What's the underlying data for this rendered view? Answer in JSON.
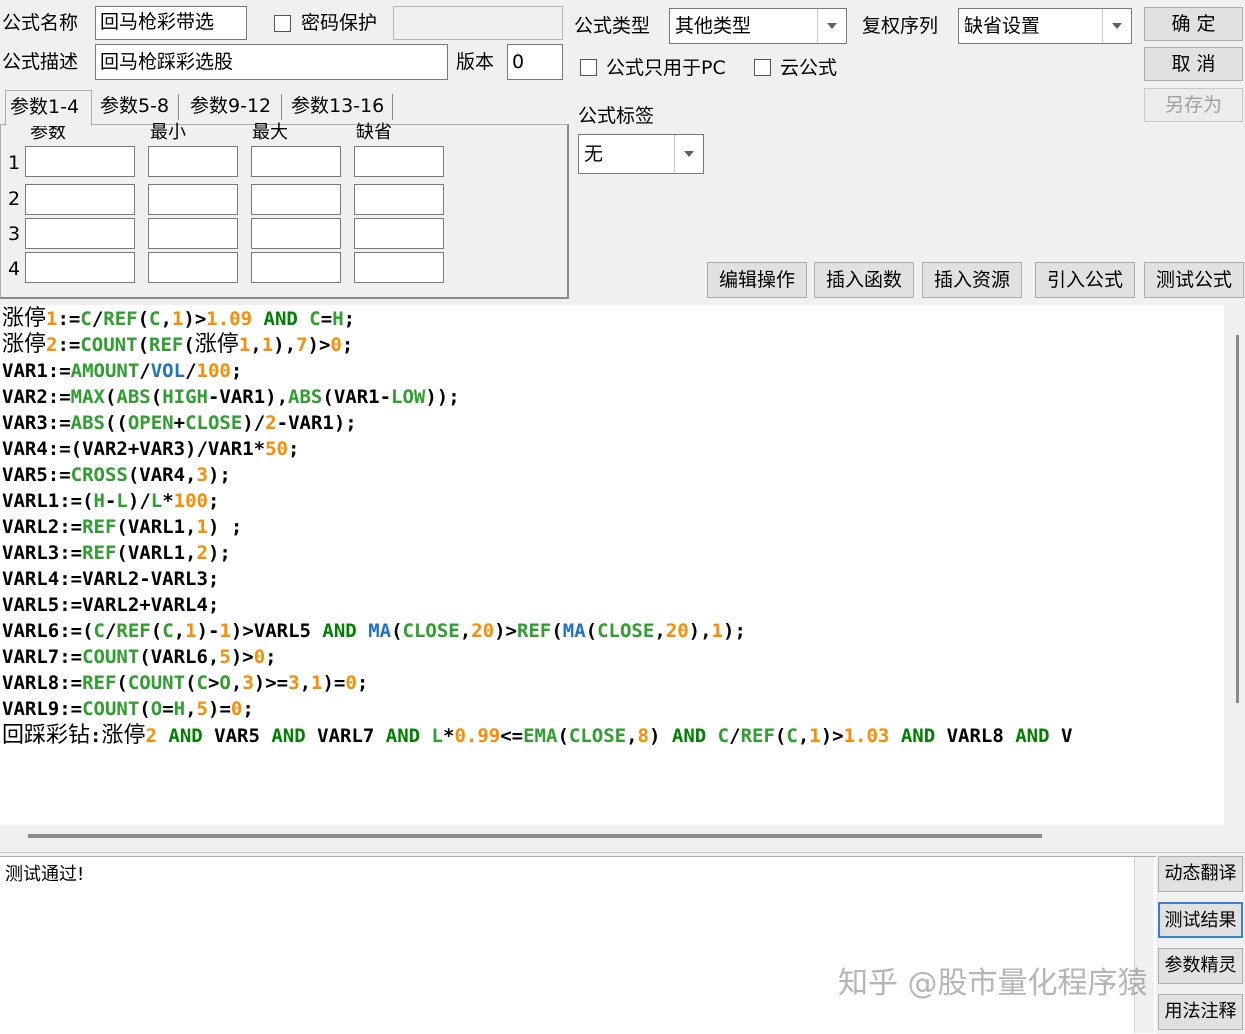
{
  "form": {
    "name_label": "公式名称",
    "name_value": "回马枪彩带选",
    "password_label": "密码保护",
    "password_value": "",
    "desc_label": "公式描述",
    "desc_value": "回马枪踩彩选股",
    "version_label": "版本",
    "version_value": "0",
    "type_label": "公式类型",
    "type_value": "其他类型",
    "rights_label": "复权序列",
    "rights_value": "缺省设置",
    "pc_only_label": "公式只用于PC",
    "cloud_label": "云公式",
    "tag_label": "公式标签",
    "tag_value": "无"
  },
  "buttons": {
    "ok": "确  定",
    "cancel": "取  消",
    "save_as": "另存为",
    "edit_op": "编辑操作",
    "insert_func": "插入函数",
    "insert_res": "插入资源",
    "import_formula": "引入公式",
    "test_formula": "测试公式"
  },
  "tabs": [
    "参数1-4",
    "参数5-8",
    "参数9-12",
    "参数13-16"
  ],
  "param_headers": [
    "参数",
    "最小",
    "最大",
    "缺省"
  ],
  "param_rows": [
    "1",
    "2",
    "3",
    "4"
  ],
  "code_lines": [
    "涨停1:=C/REF(C,1)>1.09 AND C=H;",
    "涨停2:=COUNT(REF(涨停1,1),7)>0;",
    "VAR1:=AMOUNT/VOL/100;",
    "VAR2:=MAX(ABS(HIGH-VAR1),ABS(VAR1-LOW));",
    "VAR3:=ABS((OPEN+CLOSE)/2-VAR1);",
    "VAR4:=(VAR2+VAR3)/VAR1*50;",
    "VAR5:=CROSS(VAR4,3);",
    "VARL1:=(H-L)/L*100;",
    "VARL2:=REF(VARL1,1) ;",
    "VARL3:=REF(VARL1,2);",
    "VARL4:=VARL2-VARL3;",
    "VARL5:=VARL2+VARL4;",
    "VARL6:=(C/REF(C,1)-1)>VARL5 AND MA(CLOSE,20)>REF(MA(CLOSE,20),1);",
    "VARL7:=COUNT(VARL6,5)>0;",
    "VARL8:=REF(COUNT(C>O,3)>=3,1)=0;",
    "VARL9:=COUNT(O=H,5)=0;",
    "回踩彩钻:涨停2 AND VAR5 AND VARL7 AND L*0.99<=EMA(CLOSE,8) AND C/REF(C,1)>1.03 AND VARL8 AND V"
  ],
  "output_text": "测试通过!",
  "side_buttons": [
    "动态翻译",
    "测试结果",
    "参数精灵",
    "用法注释"
  ],
  "watermark": "知乎 @股市量化程序猿"
}
